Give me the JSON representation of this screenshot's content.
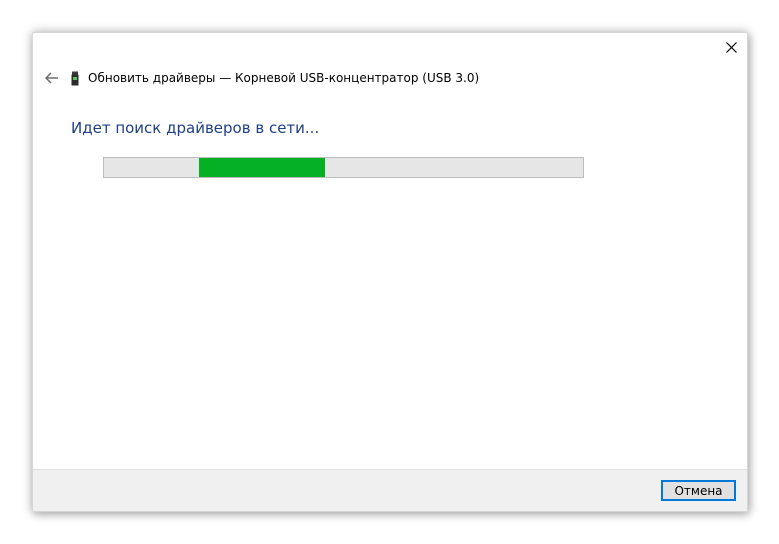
{
  "window": {
    "title": "Обновить драйверы — Корневой USB-концентратор (USB 3.0)",
    "close_icon": "close-icon",
    "back_icon": "back-arrow-icon",
    "device_icon": "usb-device-icon"
  },
  "main": {
    "heading": "Идет поиск драйверов в сети...",
    "progress": {
      "state": "indeterminate",
      "fill_color": "#06b025"
    }
  },
  "footer": {
    "cancel_label": "Отмена"
  },
  "colors": {
    "accent": "#0078d7",
    "heading": "#1e3f85"
  }
}
